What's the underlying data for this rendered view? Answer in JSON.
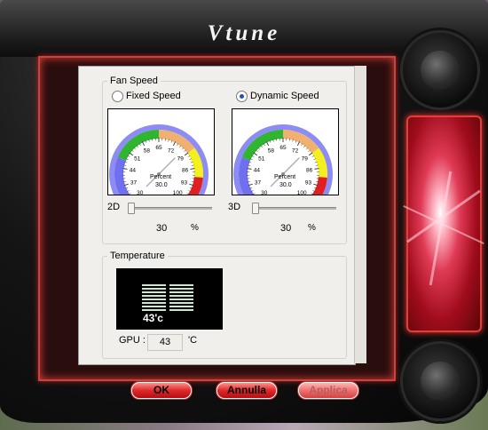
{
  "window": {
    "title": "Vtune"
  },
  "fan_speed": {
    "group_label": "Fan Speed",
    "modes": [
      {
        "label": "Fixed Speed",
        "selected": false
      },
      {
        "label": "Dynamic Speed",
        "selected": true
      }
    ],
    "gauges": [
      {
        "tick_labels": [
          "30",
          "37",
          "44",
          "51",
          "58",
          "65",
          "72",
          "79",
          "86",
          "93",
          "100"
        ],
        "caption": "Percent",
        "readout": "30.0",
        "value": 30
      },
      {
        "tick_labels": [
          "30",
          "37",
          "44",
          "51",
          "58",
          "65",
          "72",
          "79",
          "86",
          "93",
          "100"
        ],
        "caption": "Percent",
        "readout": "30.0",
        "value": 30
      }
    ],
    "sliders": [
      {
        "label": "2D",
        "value": "30",
        "unit": "%",
        "fraction": 0.0
      },
      {
        "label": "3D",
        "value": "30",
        "unit": "%",
        "fraction": 0.0
      }
    ]
  },
  "temperature": {
    "group_label": "Temperature",
    "display": "43'c",
    "gpu_label": "GPU :",
    "gpu_value": "43",
    "gpu_unit": "'C"
  },
  "buttons": {
    "ok": "OK",
    "cancel": "Annulla",
    "apply": "Applica"
  },
  "colors": {
    "accent": "#e0282a",
    "gauge_green": "#2fb52f",
    "gauge_yellow": "#f4f020",
    "gauge_red": "#e02020",
    "gauge_blue": "#6f6ff0"
  }
}
